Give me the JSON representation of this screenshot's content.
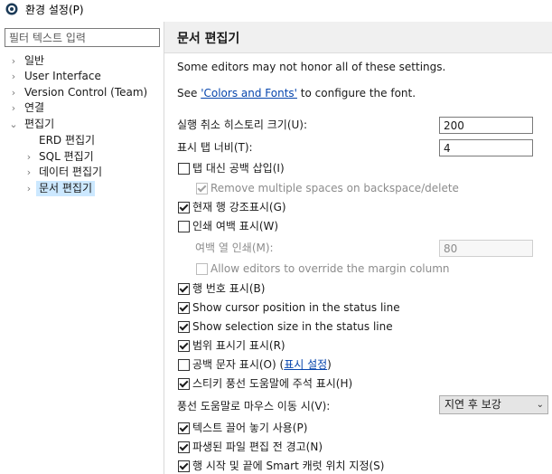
{
  "window": {
    "title": "환경 설정(P)"
  },
  "filter": {
    "placeholder": "필터 텍스트 입력"
  },
  "tree": {
    "items": [
      {
        "label": "일반",
        "expander": "›"
      },
      {
        "label": "User Interface",
        "expander": "›"
      },
      {
        "label": "Version Control (Team)",
        "expander": "›"
      },
      {
        "label": "연결",
        "expander": "›"
      },
      {
        "label": "편집기",
        "expander": "⌄"
      },
      {
        "label": "ERD 편집기",
        "expander": ""
      },
      {
        "label": "SQL 편집기",
        "expander": "›"
      },
      {
        "label": "데이터 편집기",
        "expander": "›"
      },
      {
        "label": "문서 편집기",
        "expander": "›"
      }
    ]
  },
  "page": {
    "title": "문서 편집기",
    "notice": "Some editors may not honor all of these settings.",
    "see_prefix": "See ",
    "see_link": "'Colors and Fonts'",
    "see_suffix": " to configure the font."
  },
  "fields": {
    "undo_history_label": "실행 취소 히스토리 크기(U):",
    "undo_history_value": "200",
    "tab_width_label": "표시 탭 너비(T):",
    "tab_width_value": "4",
    "print_margin_col_label": "여백 열 인쇄(M):",
    "print_margin_col_value": "80",
    "hover_label": "풍선 도움말로 마우스 이동 시(V):",
    "hover_value": "지연 후 보강"
  },
  "checkboxes": {
    "spaces_for_tabs": {
      "label": "탭 대신 공백 삽입(I)",
      "checked": false
    },
    "remove_multiple_spaces": {
      "label": "Remove multiple spaces on backspace/delete",
      "checked": true
    },
    "highlight_current_line": {
      "label": "현재 행 강조표시(G)",
      "checked": true
    },
    "show_print_margin": {
      "label": "인쇄 여백 표시(W)",
      "checked": false
    },
    "allow_override_margin": {
      "label": "Allow editors to override the margin column",
      "checked": false
    },
    "show_line_numbers": {
      "label": "행 번호 표시(B)",
      "checked": true
    },
    "cursor_position": {
      "label": "Show cursor position in the status line",
      "checked": true
    },
    "selection_size": {
      "label": "Show selection size in the status line",
      "checked": true
    },
    "range_indicator": {
      "label": "범위 표시기 표시(R)",
      "checked": true
    },
    "whitespace_chars": {
      "label_prefix": "공백 문자 표시(O) (",
      "link": "표시 설정",
      "label_suffix": ")",
      "checked": false
    },
    "sticky_hover": {
      "label": "스티키 풍선 도움말에 주석 표시(H)",
      "checked": true
    },
    "drag_drop": {
      "label": "텍스트 끌어 놓기 사용(P)",
      "checked": true
    },
    "warn_derived": {
      "label": "파생된 파일 편집 전 경고(N)",
      "checked": true
    },
    "smart_caret": {
      "label": "행 시작 및 끝에 Smart 캐럿 위치 지정(S)",
      "checked": true
    }
  },
  "colors": {
    "highlight": "#ffff33",
    "selection": "#cce8ff",
    "link": "#0645ad"
  },
  "icons": {
    "app": "eclipse-prefs-icon",
    "expander": "chevron-right-icon"
  }
}
